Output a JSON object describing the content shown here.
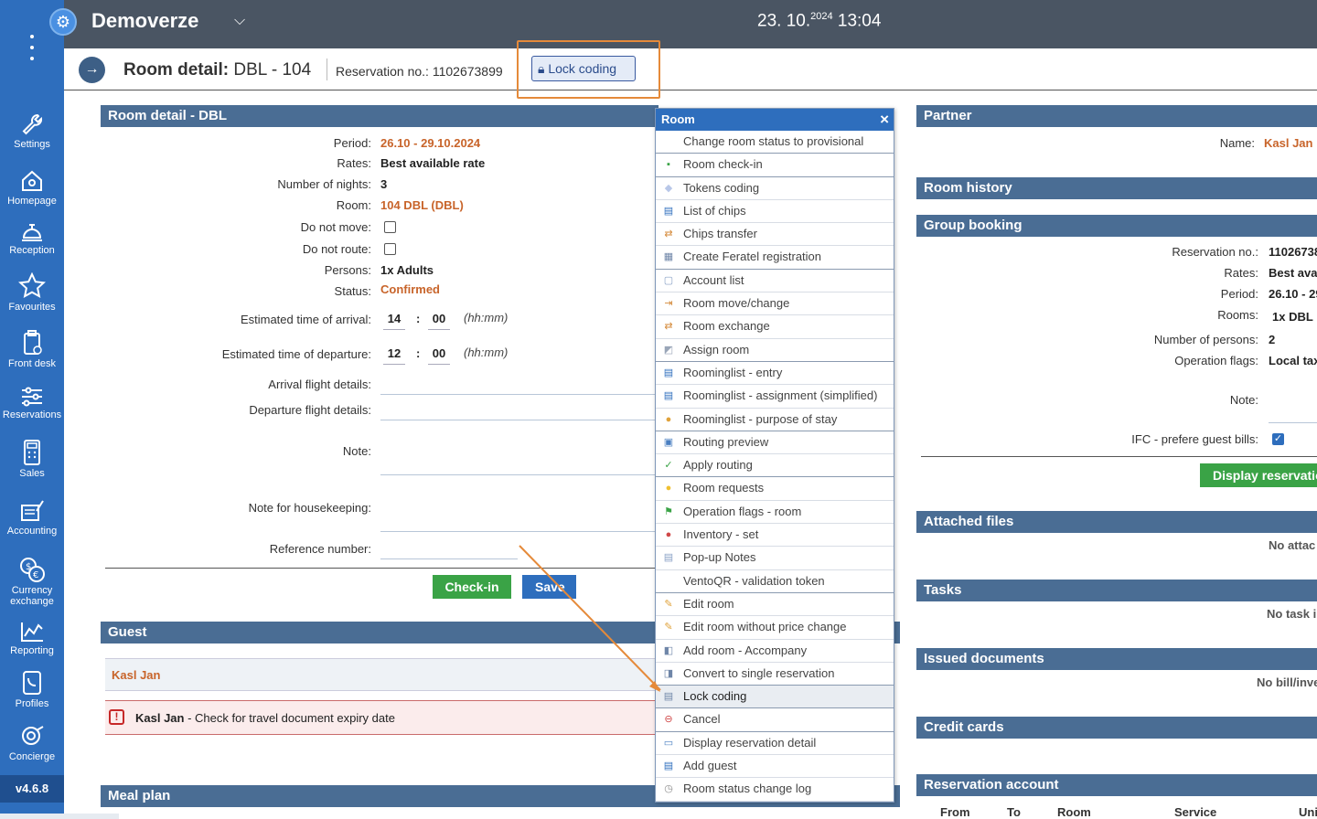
{
  "app": {
    "title": "Demoverze",
    "date": "23. 10.",
    "year": "2024",
    "time": "13:04",
    "version": "v4.6.8"
  },
  "sidebar": {
    "items": [
      {
        "label": "Settings",
        "icon": "wrench-icon"
      },
      {
        "label": "Homepage",
        "icon": "home-icon"
      },
      {
        "label": "Reception",
        "icon": "bell-icon"
      },
      {
        "label": "Favourites",
        "icon": "star-icon"
      },
      {
        "label": "Front desk",
        "icon": "clipboard-icon"
      },
      {
        "label": "Reservations",
        "icon": "sliders-icon"
      },
      {
        "label": "Sales",
        "icon": "calculator-icon"
      },
      {
        "label": "Accounting",
        "icon": "ledger-icon"
      },
      {
        "label": "Currency exchange",
        "icon": "currency-icon"
      },
      {
        "label": "Reporting",
        "icon": "chart-icon"
      },
      {
        "label": "Profiles",
        "icon": "phone-book-icon"
      },
      {
        "label": "Concierge",
        "icon": "concierge-icon"
      }
    ]
  },
  "subheader": {
    "title_prefix": "Room detail:",
    "title_value": "DBL - 104",
    "reservation": "Reservation no.: 1102673899",
    "lock_button": "Lock coding"
  },
  "room_detail": {
    "header": "Room detail - DBL",
    "period_label": "Period:",
    "period": "26.10 - 29.10.2024",
    "rates_label": "Rates:",
    "rates": "Best available rate",
    "nights_label": "Number of nights:",
    "nights": "3",
    "room_label": "Room:",
    "room": "104 DBL (DBL)",
    "do_not_move_label": "Do not move:",
    "do_not_route_label": "Do not route:",
    "persons_label": "Persons:",
    "persons": "1x Adults",
    "status_label": "Status:",
    "status": "Confirmed",
    "arrival_label": "Estimated time of arrival:",
    "arrival_hh": "14",
    "arrival_mm": "00",
    "departure_label": "Estimated time of departure:",
    "departure_hh": "12",
    "departure_mm": "00",
    "colon": ":",
    "time_unit": "(hh:mm)",
    "arrival_flight_label": "Arrival flight details:",
    "departure_flight_label": "Departure flight details:",
    "note_label": "Note:",
    "housekeeping_label": "Note for housekeeping:",
    "reference_label": "Reference number:",
    "checkin_button": "Check-in",
    "save_button": "Save"
  },
  "guest": {
    "header": "Guest",
    "name": "Kasl Jan",
    "alert_name": "Kasl Jan",
    "alert_text": " - Check for travel document expiry date"
  },
  "meal_plan": {
    "header": "Meal plan"
  },
  "menu": {
    "title": "Room",
    "close": "×",
    "items": [
      {
        "label": "Change room status to provisional",
        "icon": ""
      },
      {
        "label": "Room check-in",
        "icon": "checkin-icon"
      },
      {
        "label": "Tokens coding",
        "icon": "tag-icon"
      },
      {
        "label": "List of chips",
        "icon": "book-icon"
      },
      {
        "label": "Chips transfer",
        "icon": "transfer-icon"
      },
      {
        "label": "Create Feratel registration",
        "icon": "form-icon"
      },
      {
        "label": "Account list",
        "icon": "search-doc-icon"
      },
      {
        "label": "Room move/change",
        "icon": "move-icon"
      },
      {
        "label": "Room exchange",
        "icon": "exchange-icon"
      },
      {
        "label": "Assign room",
        "icon": "assign-icon"
      },
      {
        "label": "Roominglist - entry",
        "icon": "book-icon"
      },
      {
        "label": "Roominglist - assignment (simplified)",
        "icon": "book-icon"
      },
      {
        "label": "Roominglist - purpose of stay",
        "icon": "people-icon"
      },
      {
        "label": "Routing preview",
        "icon": "routing-icon"
      },
      {
        "label": "Apply routing",
        "icon": "check-icon"
      },
      {
        "label": "Room requests",
        "icon": "bulb-icon"
      },
      {
        "label": "Operation flags - room",
        "icon": "flag-icon"
      },
      {
        "label": "Inventory - set",
        "icon": "inventory-icon"
      },
      {
        "label": "Pop-up Notes",
        "icon": "note-icon"
      },
      {
        "label": "VentoQR - validation token",
        "icon": ""
      },
      {
        "label": "Edit room",
        "icon": "pencil-icon"
      },
      {
        "label": "Edit room without price change",
        "icon": "pencil-icon"
      },
      {
        "label": "Add room - Accompany",
        "icon": "add-room-icon"
      },
      {
        "label": "Convert to single reservation",
        "icon": "convert-icon"
      },
      {
        "label": "Lock coding",
        "icon": "lock-card-icon"
      },
      {
        "label": "Cancel",
        "icon": "cancel-icon"
      },
      {
        "label": "Display reservation detail",
        "icon": "folder-icon"
      },
      {
        "label": "Add guest",
        "icon": "book-icon"
      },
      {
        "label": "Room status change log",
        "icon": "clock-icon"
      }
    ]
  },
  "right": {
    "partner_header": "Partner",
    "name_label": "Name:",
    "partner_name": "Kasl Jan",
    "room_history_header": "Room history",
    "group_booking_header": "Group booking",
    "gb_res_label": "Reservation no.:",
    "gb_res": "11026738",
    "gb_rates_label": "Rates:",
    "gb_rates": "Best ava",
    "gb_period_label": "Period:",
    "gb_period": "26.10 - 29",
    "gb_rooms_label": "Rooms:",
    "gb_rooms": "1x DBL",
    "gb_persons_label": "Number of persons:",
    "gb_persons": "2",
    "gb_flags_label": "Operation flags:",
    "gb_flags": "Local tax",
    "gb_note_label": "Note:",
    "gb_ifc_label": "IFC - prefere guest bills:",
    "display_button": "Display reservatio",
    "attached_header": "Attached files",
    "attached_empty": "No attac",
    "tasks_header": "Tasks",
    "tasks_empty": "No task i",
    "issued_header": "Issued documents",
    "issued_empty": "No bill/inve",
    "credit_header": "Credit cards",
    "account_header": "Reservation account",
    "account_cols": [
      "From",
      "To",
      "Room",
      "Service",
      "Uni"
    ]
  }
}
